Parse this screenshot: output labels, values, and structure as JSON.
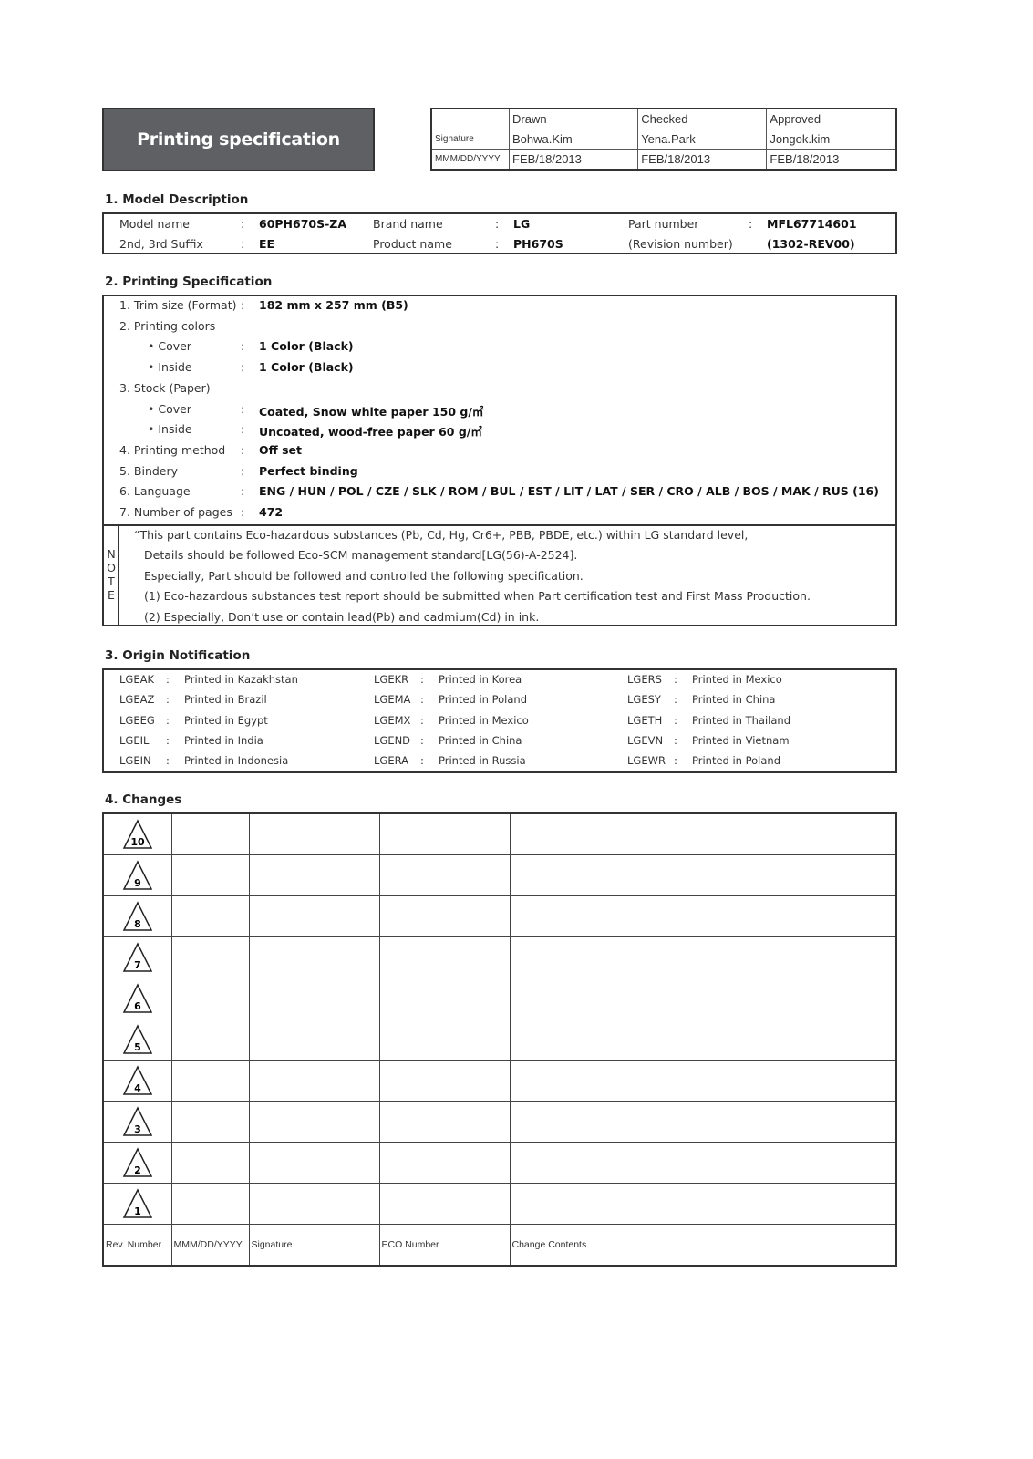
{
  "header": {
    "title": "Printing specification",
    "approval": {
      "columns": [
        "Drawn",
        "Checked",
        "Approved"
      ],
      "rows": [
        {
          "label": "Signature",
          "values": [
            "Bohwa.Kim",
            "Yena.Park",
            "Jongok.kim"
          ]
        },
        {
          "label": "MMM/DD/YYYY",
          "values": [
            "FEB/18/2013",
            "FEB/18/2013",
            "FEB/18/2013"
          ]
        }
      ]
    }
  },
  "model_description": {
    "title": "1. Model Description",
    "fields": [
      {
        "label": "Model name",
        "value": "60PH670S-ZA"
      },
      {
        "label": "Brand name",
        "value": "LG"
      },
      {
        "label": "Part number",
        "value": "MFL67714601"
      },
      {
        "label": "2nd, 3rd Suffix",
        "value": "EE"
      },
      {
        "label": "Product name",
        "value": "PH670S"
      },
      {
        "label": "(Revision number)",
        "value": "(1302-REV00)"
      }
    ],
    "separator": ":"
  },
  "printing_spec": {
    "title": "2. Printing Specification",
    "items": [
      {
        "label": "1. Trim size (Format)",
        "value": "182 mm x 257 mm (B5)"
      },
      {
        "label": "2. Printing colors",
        "value": ""
      },
      {
        "label": "• Cover",
        "value": "1 Color (Black)"
      },
      {
        "label": "• Inside",
        "value": "1 Color (Black)"
      },
      {
        "label": "3. Stock (Paper)",
        "value": ""
      },
      {
        "label": "• Cover",
        "value": "Coated, Snow white paper 150 g/㎡"
      },
      {
        "label": "• Inside",
        "value": "Uncoated, wood-free paper 60 g/㎡"
      },
      {
        "label": "4. Printing method",
        "value": "Off set"
      },
      {
        "label": "5. Bindery",
        "value": "Perfect binding"
      },
      {
        "label": "6. Language",
        "value": "ENG / HUN / POL / CZE / SLK / ROM / BUL / EST / LIT / LAT / SER / CRO / ALB / BOS / MAK / RUS (16)"
      },
      {
        "label": "7. Number of pages",
        "value": "472"
      }
    ],
    "note_label": "NOTE",
    "note_lines": [
      "“This part contains Eco-hazardous substances (Pb, Cd, Hg, Cr6+, PBB, PBDE, etc.) within LG standard level,",
      "Details should be followed Eco-SCM management standard[LG(56)-A-2524].",
      "Especially, Part should be followed and controlled the following specification.",
      "(1) Eco-hazardous substances test report should be submitted when Part certification test and First Mass Production.",
      "(2) Especially, Don’t use or contain lead(Pb) and cadmium(Cd) in ink."
    ]
  },
  "origin": {
    "title": "3. Origin Notification",
    "columns": [
      [
        {
          "code": "LGEAK",
          "text": "Printed in Kazakhstan"
        },
        {
          "code": "LGEAZ",
          "text": "Printed in Brazil"
        },
        {
          "code": "LGEEG",
          "text": "Printed in Egypt"
        },
        {
          "code": "LGEIL",
          "text": "Printed in India"
        },
        {
          "code": "LGEIN",
          "text": "Printed in Indonesia"
        }
      ],
      [
        {
          "code": "LGEKR",
          "text": "Printed in Korea"
        },
        {
          "code": "LGEMA",
          "text": "Printed in Poland"
        },
        {
          "code": "LGEMX",
          "text": "Printed in Mexico"
        },
        {
          "code": "LGEND",
          "text": "Printed in China"
        },
        {
          "code": "LGERA",
          "text": "Printed in Russia"
        }
      ],
      [
        {
          "code": "LGERS",
          "text": "Printed in Mexico"
        },
        {
          "code": "LGESY",
          "text": "Printed in China"
        },
        {
          "code": "LGETH",
          "text": "Printed in Thailand"
        },
        {
          "code": "LGEVN",
          "text": "Printed in Vietnam"
        },
        {
          "code": "LGEWR",
          "text": "Printed in Poland"
        }
      ]
    ]
  },
  "changes": {
    "title": "4. Changes",
    "revisions": [
      "10",
      "9",
      "8",
      "7",
      "6",
      "5",
      "4",
      "3",
      "2",
      "1"
    ],
    "headers": [
      "Rev. Number",
      "MMM/DD/YYYY",
      "Signature",
      "ECO Number",
      "Change Contents"
    ]
  }
}
